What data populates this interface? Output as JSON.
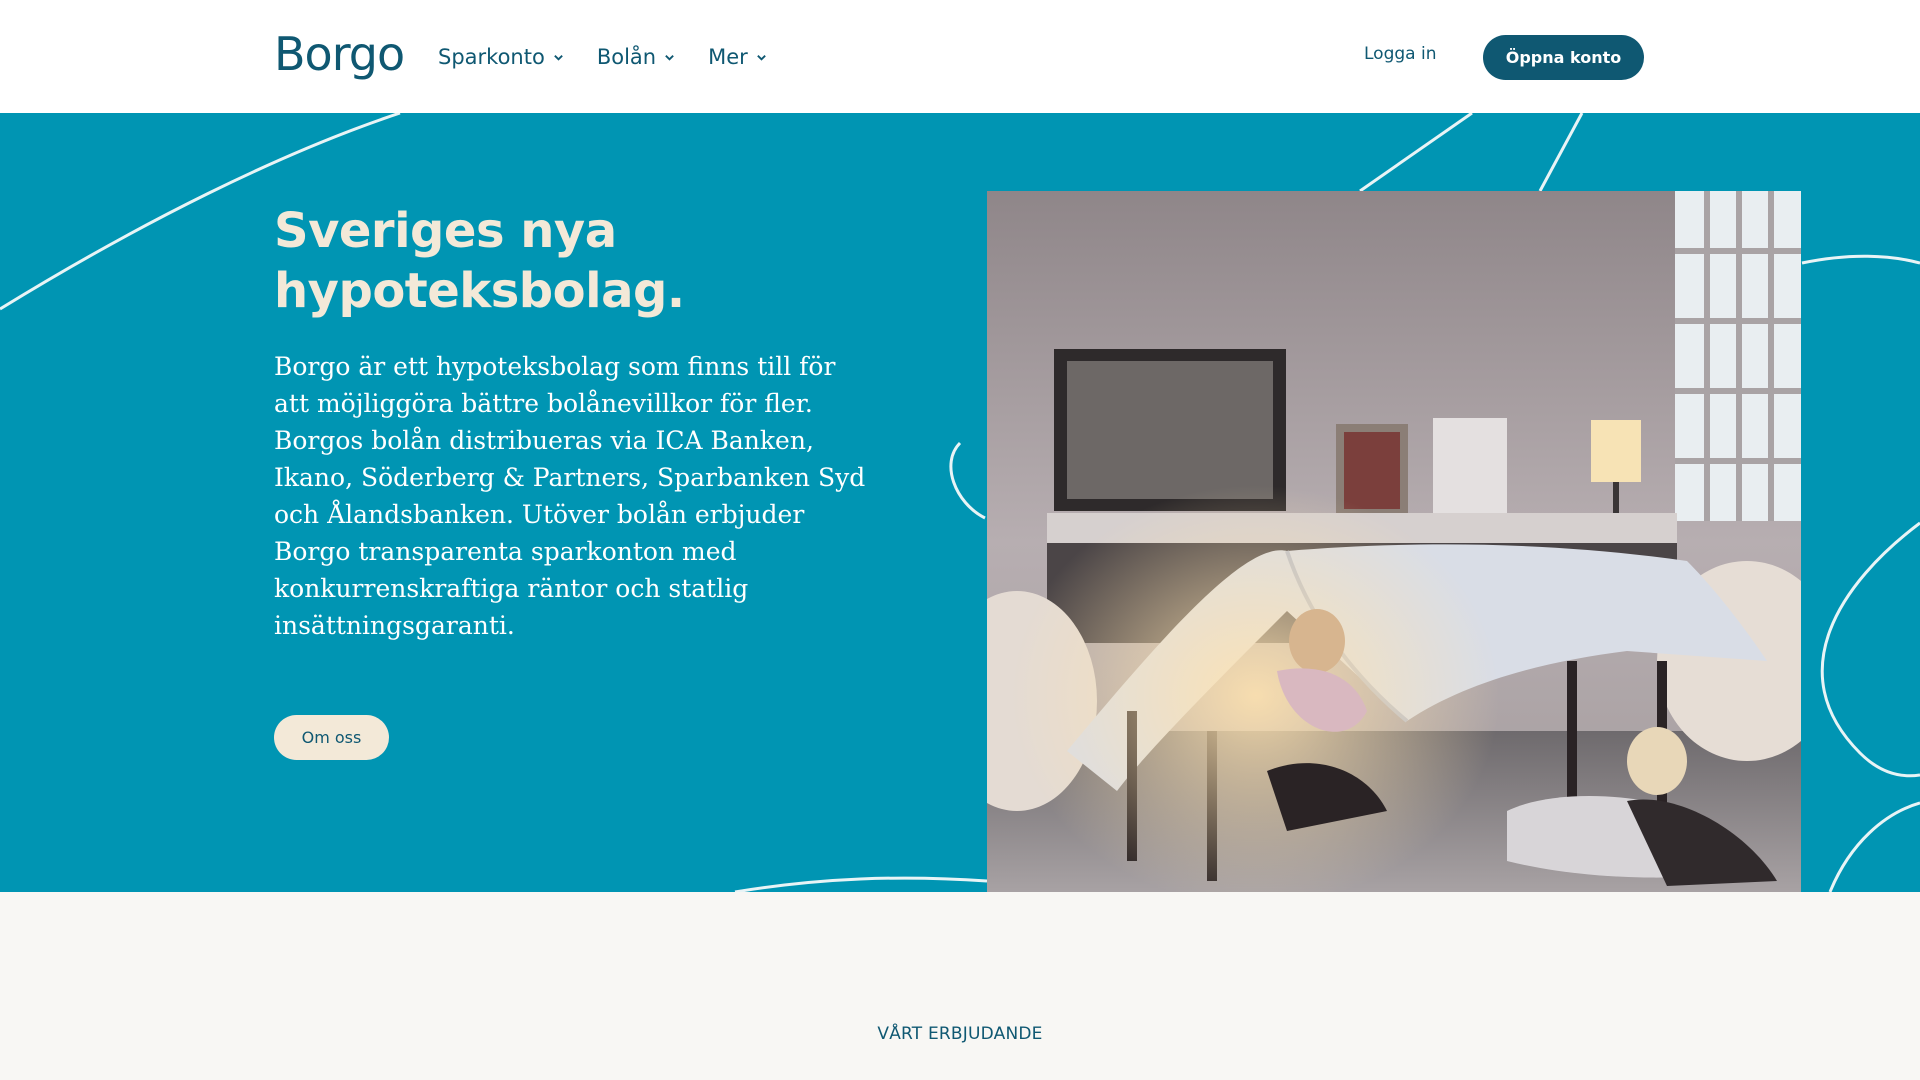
{
  "header": {
    "logo_text": "Borgo",
    "nav": [
      {
        "label": "Sparkonto"
      },
      {
        "label": "Bolån"
      },
      {
        "label": "Mer"
      }
    ],
    "login_label": "Logga in",
    "open_account_label": "Öppna konto"
  },
  "hero": {
    "title": "Sveriges nya hypoteksbolag.",
    "description": "Borgo är ett hypoteksbolag som finns till för att möjliggöra bättre bolånevillkor för fler. Borgos bolån distribueras via ICA Banken, Ikano, Söderberg & Partners, Sparbanken Syd och Ålandsbanken. Utöver bolån erbjuder Borgo transparenta sparkonton med konkurrenskraftiga räntor och statlig insättningsgaranti.",
    "about_button": "Om oss"
  },
  "offer": {
    "section_label": "VÅRT ERBJUDANDE"
  },
  "colors": {
    "brand": "#0f5872",
    "hero_bg": "#0095b3",
    "cream": "#f3e9d8",
    "page_bg": "#f8f7f4"
  }
}
